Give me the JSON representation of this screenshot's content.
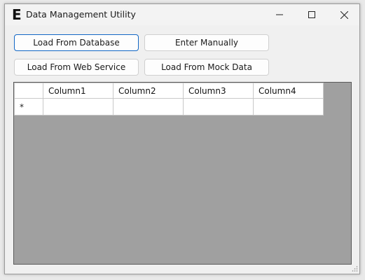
{
  "window": {
    "title": "Data Management Utility",
    "app_icon_glyph": "E",
    "colors": {
      "grid_background": "#a0a0a0",
      "focus_border": "#1166c4"
    }
  },
  "titlebar": {
    "minimize_icon": "minimize-icon",
    "maximize_icon": "maximize-icon",
    "close_icon": "close-icon"
  },
  "buttons": {
    "load_db": "Load From Database",
    "enter_manually": "Enter Manually",
    "load_web": "Load From Web Service",
    "load_mock": "Load From Mock Data"
  },
  "grid": {
    "columns": [
      "Column1",
      "Column2",
      "Column3",
      "Column4"
    ],
    "new_row_marker": "*",
    "rows": [
      [
        "",
        "",
        "",
        ""
      ]
    ]
  }
}
